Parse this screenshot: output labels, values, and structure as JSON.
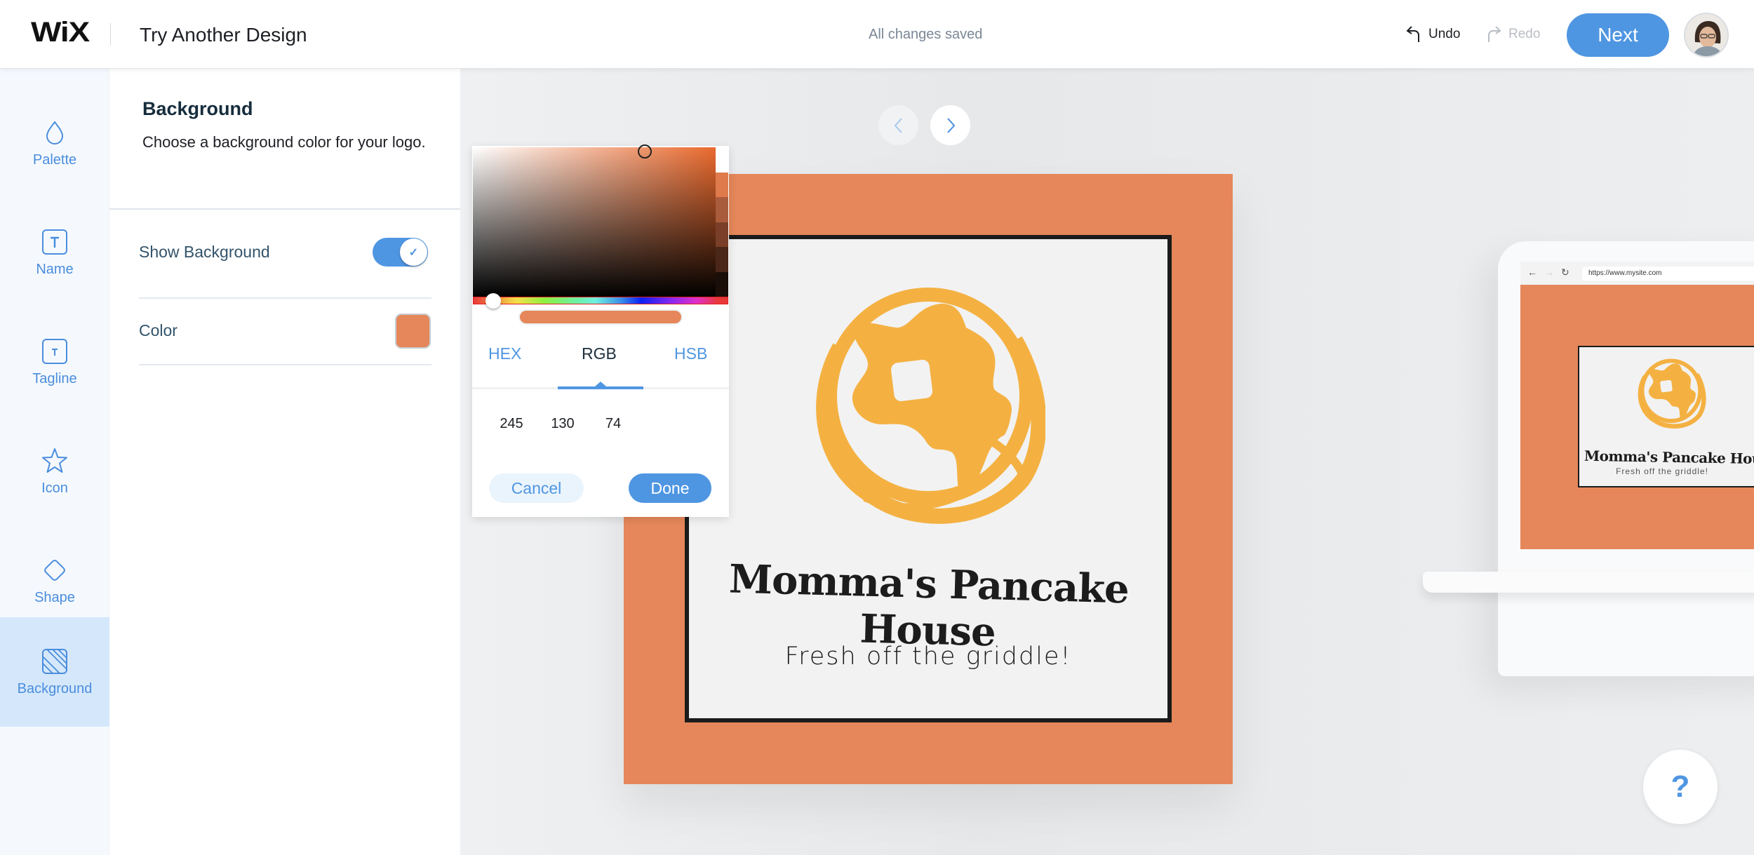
{
  "header": {
    "logo": "WiX",
    "title": "Try Another Design",
    "save_status": "All changes saved",
    "undo_label": "Undo",
    "redo_label": "Redo",
    "next_label": "Next"
  },
  "sidebar": {
    "items": [
      {
        "label": "Palette",
        "icon": "drop-icon"
      },
      {
        "label": "Name",
        "icon": "text-box-icon"
      },
      {
        "label": "Tagline",
        "icon": "text-box-small-icon"
      },
      {
        "label": "Icon",
        "icon": "star-icon"
      },
      {
        "label": "Shape",
        "icon": "diamond-icon"
      },
      {
        "label": "Background",
        "icon": "hatched-square-icon",
        "active": true
      }
    ]
  },
  "panel": {
    "title": "Background",
    "description": "Choose a background color for your logo.",
    "show_background_label": "Show Background",
    "show_background_on": true,
    "color_label": "Color",
    "color_value": "#E5875A"
  },
  "color_picker": {
    "tabs": [
      "HEX",
      "RGB",
      "HSB"
    ],
    "active_tab": "RGB",
    "rgb": {
      "r": "245",
      "g": "130",
      "b": "74"
    },
    "cancel_label": "Cancel",
    "done_label": "Done",
    "swatches": [
      "#ffffff",
      "#de7a4c",
      "#a95c3c",
      "#7a3f28",
      "#4a2718",
      "#1a0e08"
    ]
  },
  "canvas": {
    "logo": {
      "name": "Momma's Pancake House",
      "tagline": "Fresh off the griddle!",
      "background_color": "#E5875A",
      "icon_color": "#F4B142"
    },
    "preview": {
      "url": "https://www.mysite.com"
    },
    "help_label": "?"
  }
}
